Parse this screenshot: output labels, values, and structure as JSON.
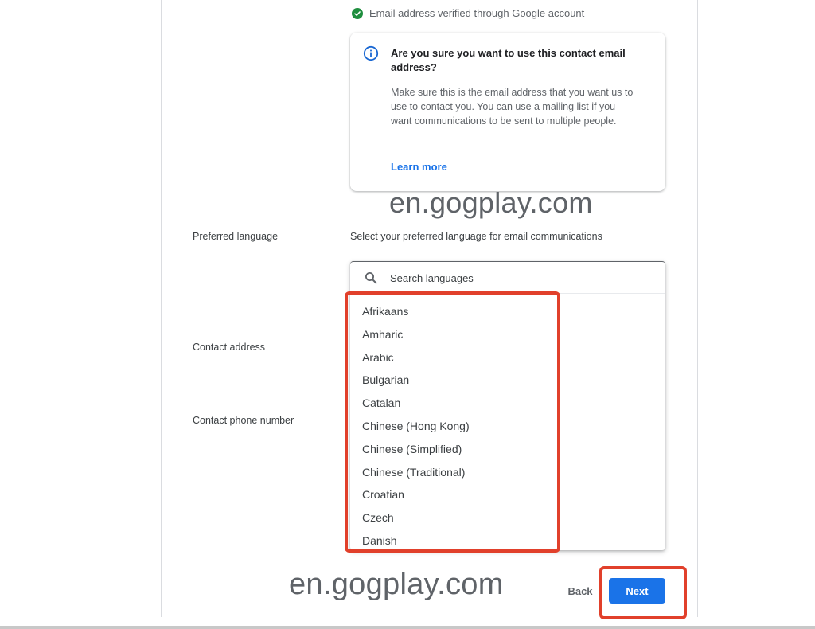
{
  "colors": {
    "accent": "#1a73e8",
    "verified_green": "#1e8e3e",
    "highlight_red": "#e1402b"
  },
  "email": {
    "verified_text": "Email address verified through Google account",
    "verified_icon": "check-circle-icon"
  },
  "info_card": {
    "icon": "info-icon",
    "title": "Are you sure you want to use this contact email address?",
    "body": "Make sure this is the email address that you want us to use to contact you. You can use a mailing list if you want communications to be sent to multiple people.",
    "learn_more": "Learn more"
  },
  "watermark": {
    "text": "en.gogplay.com"
  },
  "labels": {
    "preferred_language": "Preferred language",
    "contact_address": "Contact address",
    "contact_phone": "Contact phone number"
  },
  "preferred_language_help": "Select your preferred language for email communications",
  "language_dropdown": {
    "search_placeholder": "Search languages",
    "search_icon": "search-icon",
    "options": [
      "Afrikaans",
      "Amharic",
      "Arabic",
      "Bulgarian",
      "Catalan",
      "Chinese (Hong Kong)",
      "Chinese (Simplified)",
      "Chinese (Traditional)",
      "Croatian",
      "Czech",
      "Danish"
    ]
  },
  "footer": {
    "back_label": "Back",
    "next_label": "Next"
  }
}
